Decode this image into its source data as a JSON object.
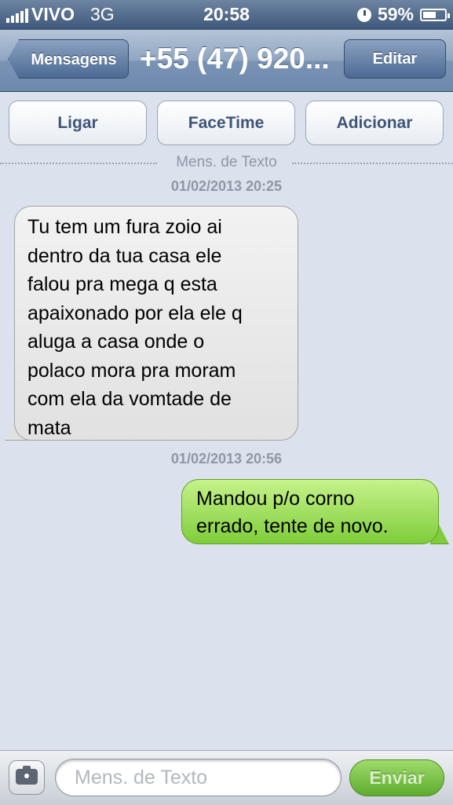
{
  "status_bar": {
    "carrier": "VIVO",
    "network": "3G",
    "time": "20:58",
    "battery": "59%",
    "battery_level": 0.59
  },
  "nav": {
    "back_label": "Mensagens",
    "title": "+55 (47) 920...",
    "edit_label": "Editar"
  },
  "actions": {
    "call": "Ligar",
    "facetime": "FaceTime",
    "add": "Adicionar"
  },
  "thread": {
    "section_label": "Mens. de Texto",
    "timestamp_1": "01/02/2013 20:25",
    "timestamp_2": "01/02/2013 20:56",
    "received_lines": [
      "Tu tem um fura zoio ai",
      "dentro da tua casa ele",
      "falou pra mega q esta",
      "apaixonado por ela ele q",
      "aluga a casa onde o",
      "polaco mora pra moram",
      "com ela da vomtade de",
      "mata"
    ],
    "sent_lines": [
      "Mandou p/o corno",
      "errado, tente de novo."
    ]
  },
  "composer": {
    "placeholder": "Mens. de Texto",
    "value": "",
    "send_label": "Enviar",
    "camera_icon": "camera-icon"
  },
  "colors": {
    "nav_accent": "#6d88ad",
    "received_bubble": "#e1e1e1",
    "sent_bubble": "#7fcd3b",
    "background": "#dbe2ed"
  }
}
